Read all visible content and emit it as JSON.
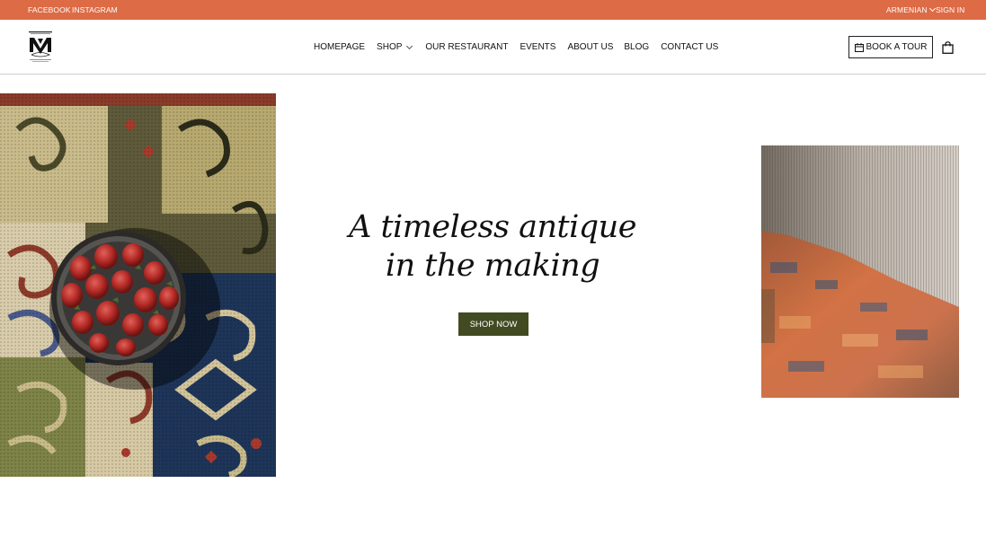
{
  "topbar": {
    "facebook": "FACEBOOK",
    "instagram": "INSTAGRAM",
    "language": "ARMENIAN",
    "sign_in": "SIGN IN",
    "bg_color": "#dd6b45"
  },
  "brand": {
    "logo_icon": "mkrtchian-monogram-logo"
  },
  "nav": {
    "homepage": "HOMEPAGE",
    "shop": "SHOP",
    "restaurant": "OUR RESTAURANT",
    "events": "EVENTS",
    "about": "ABOUT US",
    "blog": "BLOG",
    "contact": "CONTACT US"
  },
  "header": {
    "book_tour": "BOOK A TOUR",
    "calendar_icon": "calendar-icon",
    "cart_icon": "shopping-bag-icon"
  },
  "hero": {
    "headline_line1": "A timeless antique",
    "headline_line2": "in the making",
    "cta": "SHOP NOW",
    "cta_color": "#424a22",
    "left_image": "carpet-with-strawberry-bowl-photo",
    "right_image": "loom-weaving-photo"
  }
}
